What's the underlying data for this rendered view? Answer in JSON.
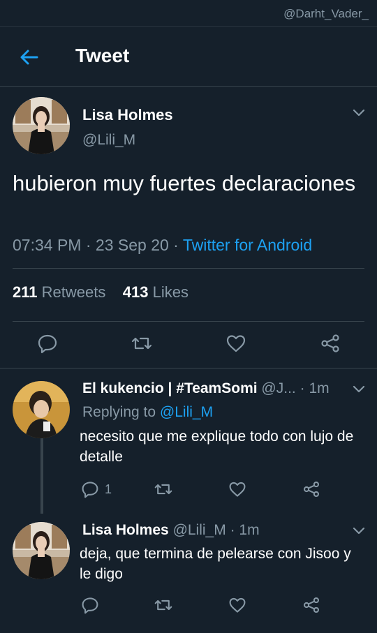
{
  "watermark": "@Darht_Vader_",
  "header": {
    "title": "Tweet"
  },
  "main_tweet": {
    "name": "Lisa Holmes",
    "handle": "@Lili_M",
    "text": "hubieron muy fuertes declaraciones",
    "time": "07:34 PM",
    "date": "23 Sep 20",
    "separator": "·",
    "source": "Twitter for Android",
    "retweets": "211",
    "retweets_label": "Retweets",
    "likes": "413",
    "likes_label": "Likes"
  },
  "replies": [
    {
      "name": "El kukencio | #TeamSomi",
      "handle": "@J...",
      "separator": "·",
      "time": "1m",
      "replying_prefix": "Replying to",
      "replying_to": "@Lili_M",
      "text": "necesito que me explique todo con lujo de detalle",
      "reply_count": "1"
    },
    {
      "name": "Lisa Holmes",
      "handle": "@Lili_M",
      "separator": "·",
      "time": "1m",
      "text": "deja, que termina de pelearse con Jisoo y le digo"
    }
  ],
  "colors": {
    "background": "#15202b",
    "accent": "#1da1f2",
    "muted": "#8899a6",
    "divider": "#38444d"
  },
  "icons": [
    "back-arrow-icon",
    "chevron-down-icon",
    "reply-icon",
    "retweet-icon",
    "like-icon",
    "share-icon"
  ]
}
